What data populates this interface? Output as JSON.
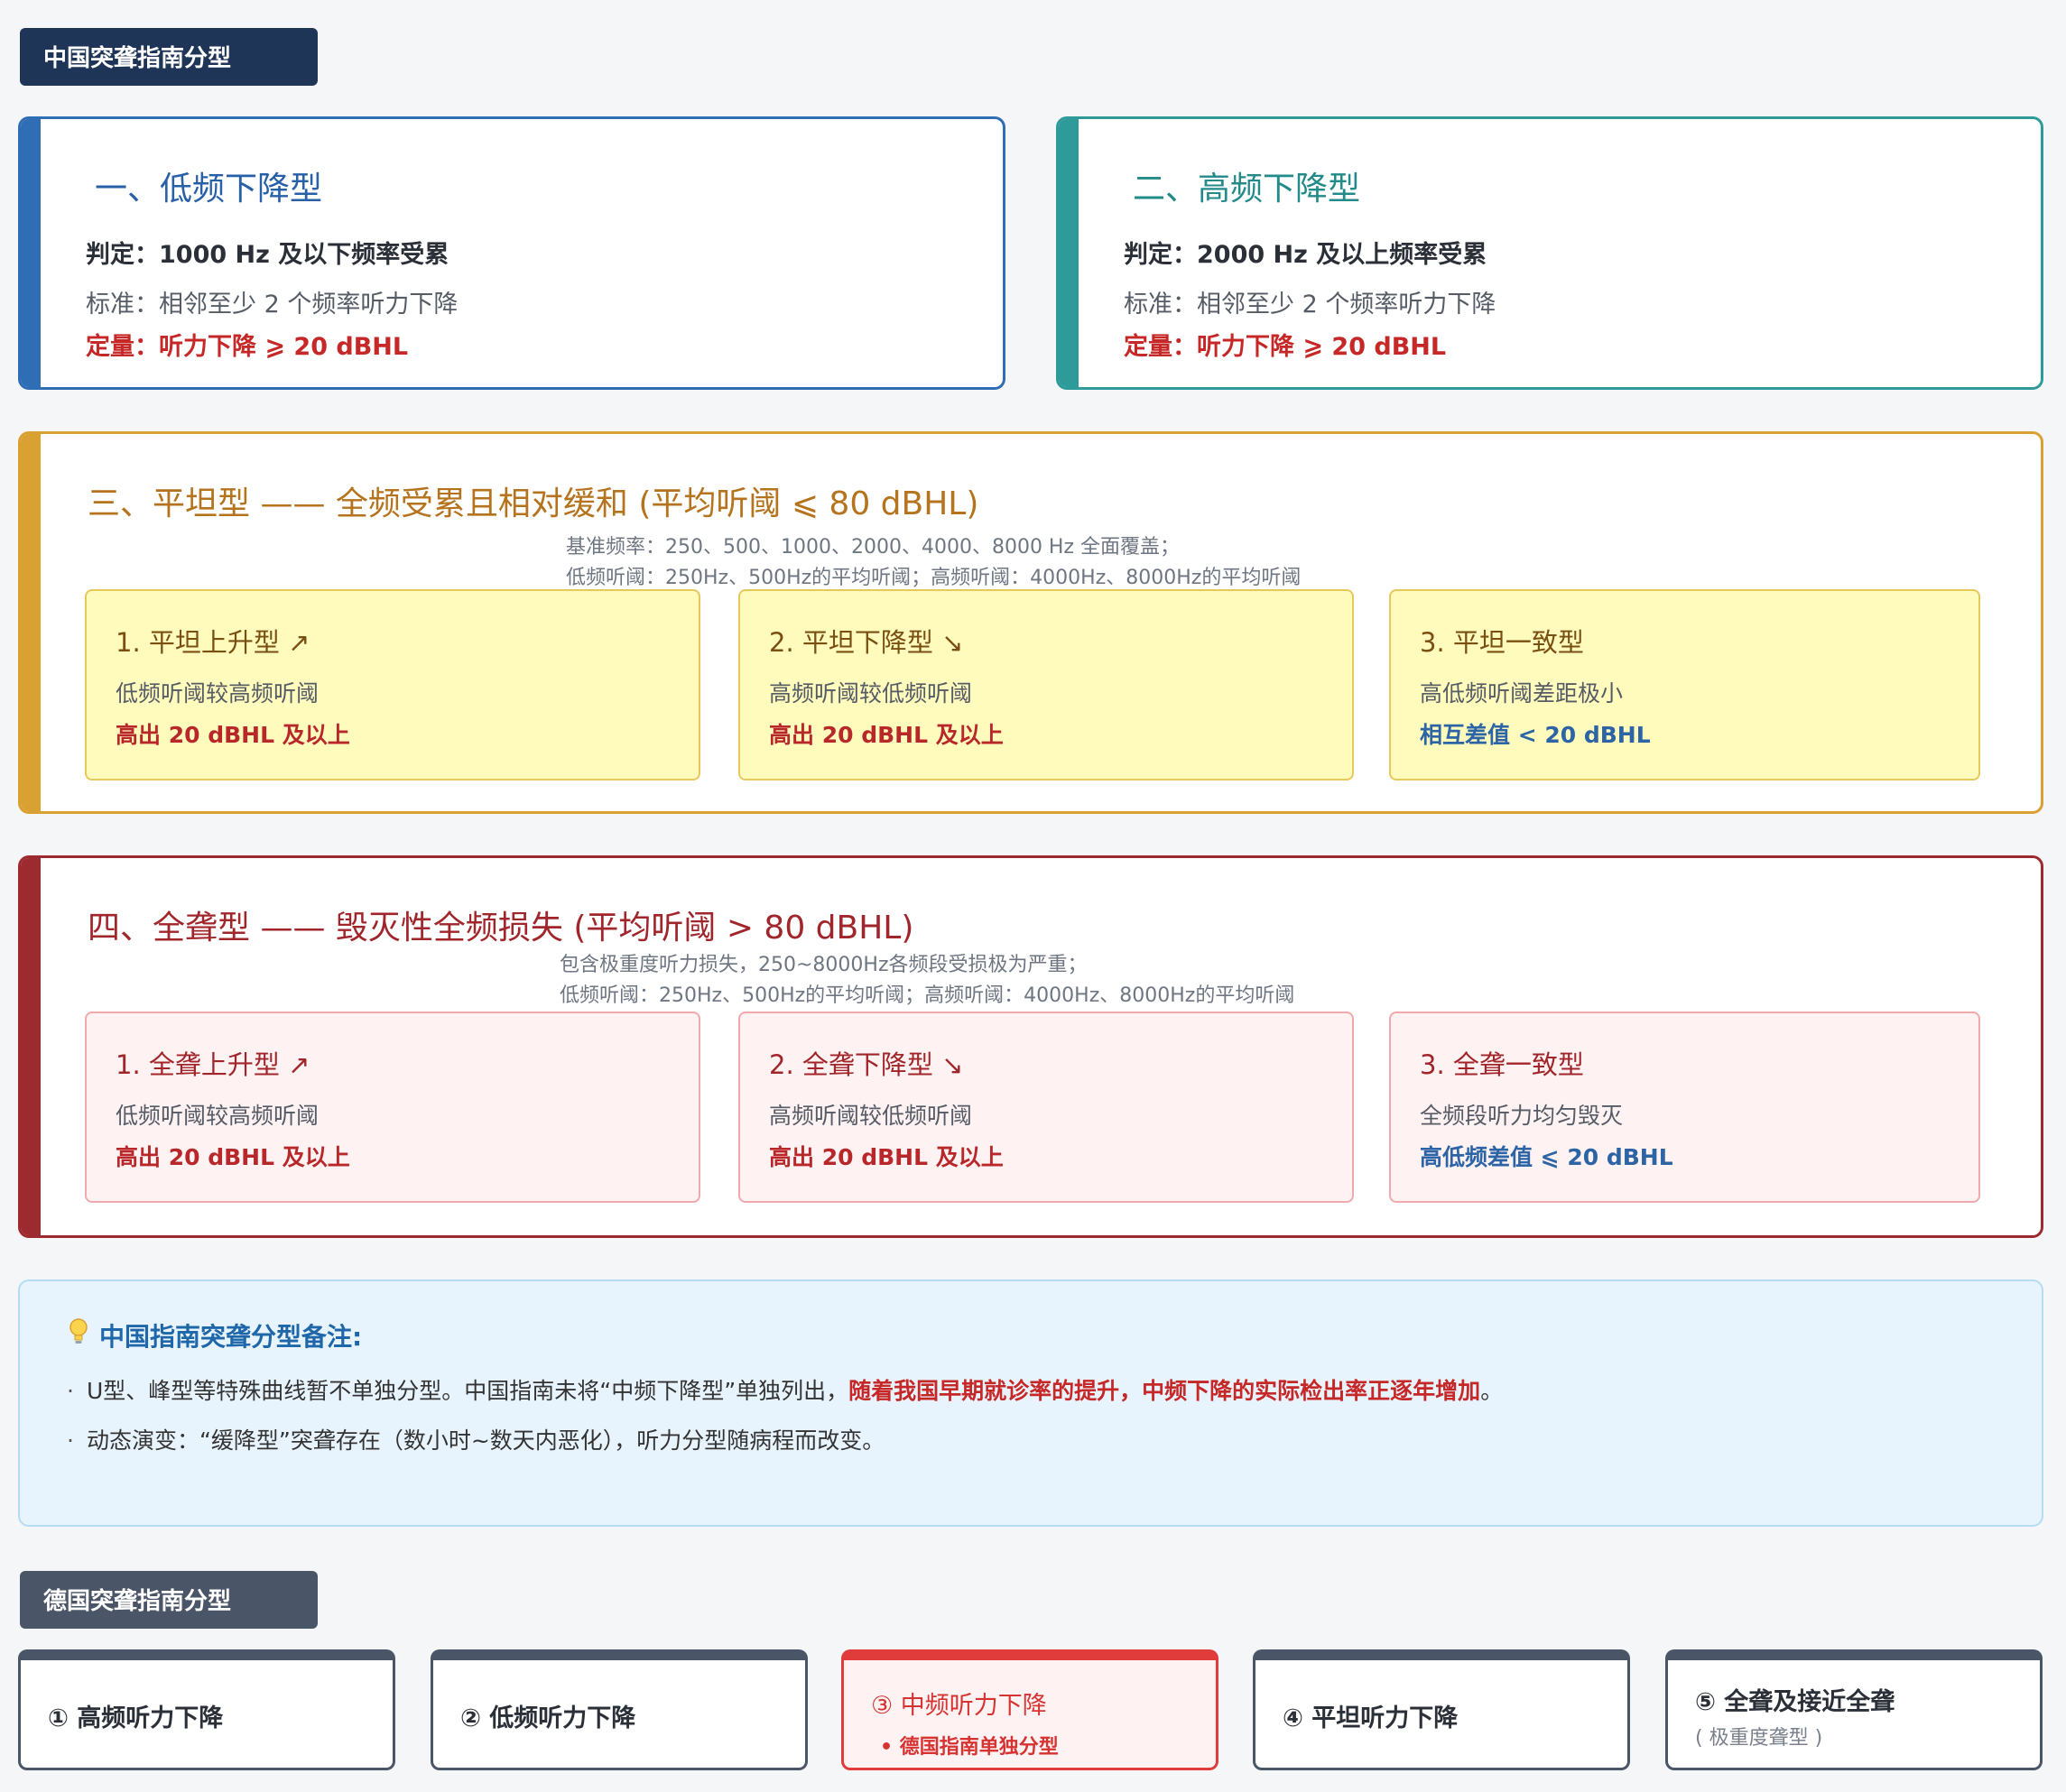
{
  "china": {
    "tag": "中国突聋指南分型",
    "low": {
      "title": "一、低频下降型",
      "judge": "判定：1000 Hz 及以下频率受累",
      "standard": "标准：相邻至少 2 个频率听力下降",
      "quant": "定量：听力下降 ⩾ 20 dBHL"
    },
    "high": {
      "title": "二、高频下降型",
      "judge": "判定：2000 Hz 及以上频率受累",
      "standard": "标准：相邻至少 2 个频率听力下降",
      "quant": "定量：听力下降 ⩾ 20 dBHL"
    },
    "flat": {
      "title": "三、平坦型 —— 全频受累且相对缓和 (平均听阈 ⩽ 80 dBHL)",
      "note1": "基准频率：250、500、1000、2000、4000、8000 Hz 全面覆盖；",
      "note2": "低频听阈：250Hz、500Hz的平均听阈；高频听阈：4000Hz、8000Hz的平均听阈",
      "items": [
        {
          "title": "1. 平坦上升型 ↗",
          "desc": "低频听阈较高频听阈",
          "value": "高出 20 dBHL 及以上"
        },
        {
          "title": "2. 平坦下降型 ↘",
          "desc": "高频听阈较低频听阈",
          "value": "高出 20 dBHL 及以上"
        },
        {
          "title": "3. 平坦一致型",
          "desc": "高低频听阈差距极小",
          "value": "相互差值 < 20 dBHL"
        }
      ]
    },
    "deaf": {
      "title": "四、全聋型 —— 毁灭性全频损失 (平均听阈 > 80 dBHL)",
      "note1": "包含极重度听力损失，250~8000Hz各频段受损极为严重；",
      "note2": "低频听阈：250Hz、500Hz的平均听阈；高频听阈：4000Hz、8000Hz的平均听阈",
      "items": [
        {
          "title": "1. 全聋上升型 ↗",
          "desc": "低频听阈较高频听阈",
          "value": "高出 20 dBHL 及以上"
        },
        {
          "title": "2. 全聋下降型 ↘",
          "desc": "高频听阈较低频听阈",
          "value": "高出 20 dBHL 及以上"
        },
        {
          "title": "3. 全聋一致型",
          "desc": "全频段听力均匀毁灭",
          "value": "高低频差值 ⩽ 20 dBHL"
        }
      ]
    },
    "remark": {
      "icon": "lightbulb-icon",
      "title": "中国指南突聋分型备注:",
      "bullet1_text": "U型、峰型等特殊曲线暂不单独分型。中国指南未将“中频下降型”单独列出，",
      "bullet1_highlight": "随着我国早期就诊率的提升，中频下降的实际检出率正逐年增加",
      "bullet1_end": "。",
      "bullet2": "动态演变：“缓降型”突聋存在（数小时~数天内恶化），听力分型随病程而改变。"
    }
  },
  "germany": {
    "tag": "德国突聋指南分型",
    "items": [
      {
        "label": "① 高频听力下降"
      },
      {
        "label": "② 低频听力下降"
      },
      {
        "label": "③ 中频听力下降",
        "sub": "德国指南单独分型"
      },
      {
        "label": "④ 平坦听力下降"
      },
      {
        "label": "⑤ 全聋及接近全聋",
        "sub": "( 极重度聋型 )"
      }
    ]
  },
  "colors": {
    "low": "#2f6db5",
    "high": "#2e9a9a",
    "flat": "#d9a032",
    "deaf": "#9c2a2e",
    "highlight": "#c62828"
  }
}
